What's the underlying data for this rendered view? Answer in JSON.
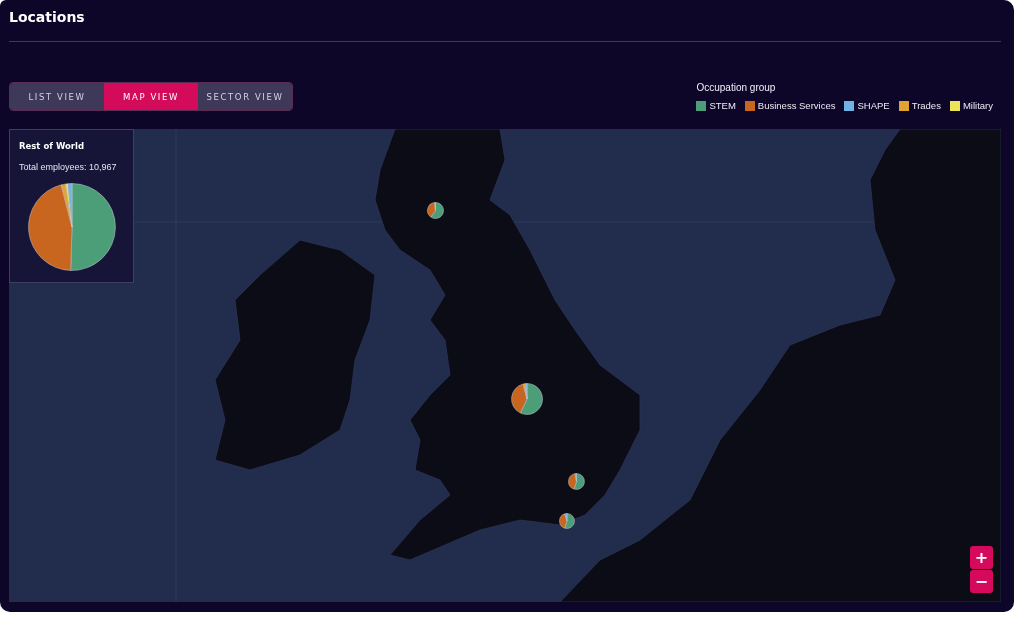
{
  "page": {
    "title": "Locations"
  },
  "view_tabs": [
    {
      "label": "LIST VIEW",
      "selected": false
    },
    {
      "label": "MAP VIEW",
      "selected": true
    },
    {
      "label": "SECTOR VIEW",
      "selected": false
    }
  ],
  "legend": {
    "title": "Occupation group",
    "items": [
      {
        "label": "STEM",
        "color": "#4c9e79"
      },
      {
        "label": "Business Services",
        "color": "#c8661f"
      },
      {
        "label": "SHAPE",
        "color": "#6fb3e4"
      },
      {
        "label": "Trades",
        "color": "#e0a431"
      },
      {
        "label": "Military",
        "color": "#ece55a"
      }
    ]
  },
  "summary_panel": {
    "title": "Rest of World",
    "total": "Total employees: 10,967"
  },
  "zoom_controls": [
    "+",
    "−"
  ]
}
